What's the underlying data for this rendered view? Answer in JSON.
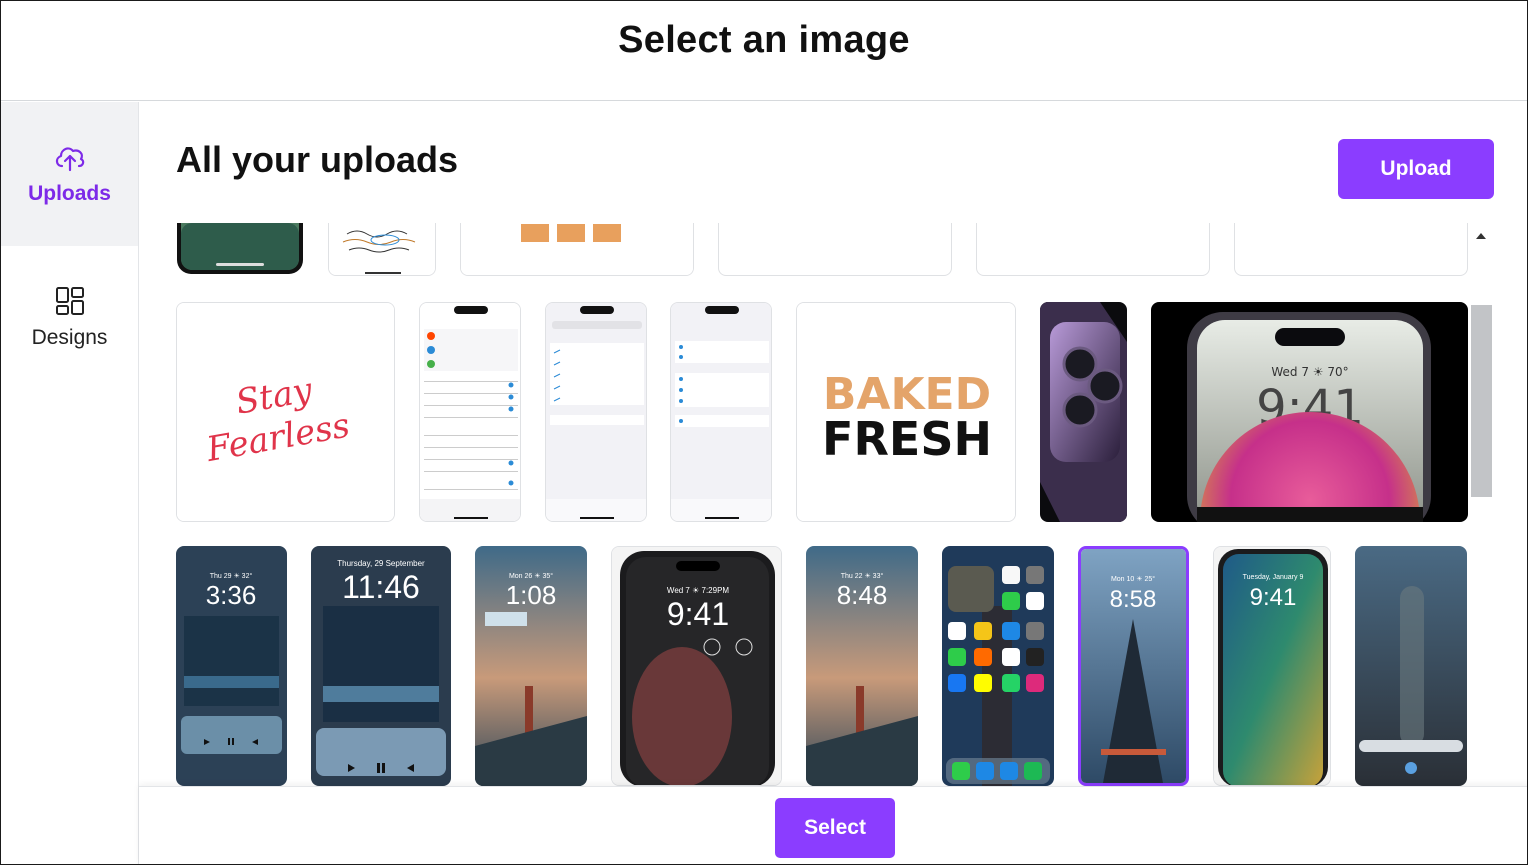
{
  "header": {
    "title": "Select an image"
  },
  "sidebar": {
    "items": [
      {
        "label": "Uploads",
        "icon": "cloud-upload-icon",
        "active": true
      },
      {
        "label": "Designs",
        "icon": "grid-layout-icon",
        "active": false
      }
    ]
  },
  "main": {
    "title": "All your uploads",
    "upload_label": "Upload"
  },
  "tiles": {
    "row2": {
      "stay_fearless": {
        "line1": "Stay",
        "line2": "Fearless"
      },
      "baked_fresh": {
        "line1": "BAKED",
        "line2": "FRESH"
      },
      "iphone_lock": {
        "date": "Wed 7 ☀ 70°",
        "time": "9:41"
      }
    },
    "row3": [
      {
        "date": "Thu 29 ☀ 32°",
        "time": "3:36"
      },
      {
        "date": "Thursday, 29 September",
        "time": "11:46"
      },
      {
        "date": "Mon 26 ☀ 35°",
        "time": "1:08"
      },
      {
        "date": "Wed 7 ☀ 7:29PM",
        "time": "9:41"
      },
      {
        "date": "Thu 22 ☀ 33°",
        "time": "8:48"
      },
      {
        "date": "",
        "time": ""
      },
      {
        "date": "Mon 10 ☀ 25°",
        "time": "8:58"
      },
      {
        "date": "Tuesday, January 9",
        "time": "9:41"
      },
      {
        "date": "",
        "time": ""
      }
    ]
  },
  "footer": {
    "select_label": "Select"
  },
  "colors": {
    "accent": "#8b3dff",
    "accent_text": "#7d2ae8"
  }
}
